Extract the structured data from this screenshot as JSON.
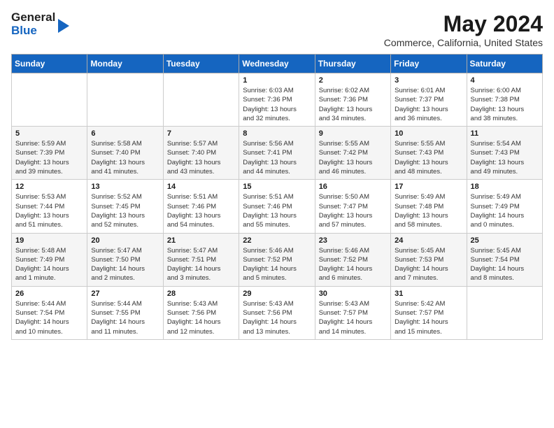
{
  "logo": {
    "general": "General",
    "blue": "Blue"
  },
  "title": "May 2024",
  "subtitle": "Commerce, California, United States",
  "days_of_week": [
    "Sunday",
    "Monday",
    "Tuesday",
    "Wednesday",
    "Thursday",
    "Friday",
    "Saturday"
  ],
  "weeks": [
    [
      {
        "day": "",
        "content": ""
      },
      {
        "day": "",
        "content": ""
      },
      {
        "day": "",
        "content": ""
      },
      {
        "day": "1",
        "content": "Sunrise: 6:03 AM\nSunset: 7:36 PM\nDaylight: 13 hours\nand 32 minutes."
      },
      {
        "day": "2",
        "content": "Sunrise: 6:02 AM\nSunset: 7:36 PM\nDaylight: 13 hours\nand 34 minutes."
      },
      {
        "day": "3",
        "content": "Sunrise: 6:01 AM\nSunset: 7:37 PM\nDaylight: 13 hours\nand 36 minutes."
      },
      {
        "day": "4",
        "content": "Sunrise: 6:00 AM\nSunset: 7:38 PM\nDaylight: 13 hours\nand 38 minutes."
      }
    ],
    [
      {
        "day": "5",
        "content": "Sunrise: 5:59 AM\nSunset: 7:39 PM\nDaylight: 13 hours\nand 39 minutes."
      },
      {
        "day": "6",
        "content": "Sunrise: 5:58 AM\nSunset: 7:40 PM\nDaylight: 13 hours\nand 41 minutes."
      },
      {
        "day": "7",
        "content": "Sunrise: 5:57 AM\nSunset: 7:40 PM\nDaylight: 13 hours\nand 43 minutes."
      },
      {
        "day": "8",
        "content": "Sunrise: 5:56 AM\nSunset: 7:41 PM\nDaylight: 13 hours\nand 44 minutes."
      },
      {
        "day": "9",
        "content": "Sunrise: 5:55 AM\nSunset: 7:42 PM\nDaylight: 13 hours\nand 46 minutes."
      },
      {
        "day": "10",
        "content": "Sunrise: 5:55 AM\nSunset: 7:43 PM\nDaylight: 13 hours\nand 48 minutes."
      },
      {
        "day": "11",
        "content": "Sunrise: 5:54 AM\nSunset: 7:43 PM\nDaylight: 13 hours\nand 49 minutes."
      }
    ],
    [
      {
        "day": "12",
        "content": "Sunrise: 5:53 AM\nSunset: 7:44 PM\nDaylight: 13 hours\nand 51 minutes."
      },
      {
        "day": "13",
        "content": "Sunrise: 5:52 AM\nSunset: 7:45 PM\nDaylight: 13 hours\nand 52 minutes."
      },
      {
        "day": "14",
        "content": "Sunrise: 5:51 AM\nSunset: 7:46 PM\nDaylight: 13 hours\nand 54 minutes."
      },
      {
        "day": "15",
        "content": "Sunrise: 5:51 AM\nSunset: 7:46 PM\nDaylight: 13 hours\nand 55 minutes."
      },
      {
        "day": "16",
        "content": "Sunrise: 5:50 AM\nSunset: 7:47 PM\nDaylight: 13 hours\nand 57 minutes."
      },
      {
        "day": "17",
        "content": "Sunrise: 5:49 AM\nSunset: 7:48 PM\nDaylight: 13 hours\nand 58 minutes."
      },
      {
        "day": "18",
        "content": "Sunrise: 5:49 AM\nSunset: 7:49 PM\nDaylight: 14 hours\nand 0 minutes."
      }
    ],
    [
      {
        "day": "19",
        "content": "Sunrise: 5:48 AM\nSunset: 7:49 PM\nDaylight: 14 hours\nand 1 minute."
      },
      {
        "day": "20",
        "content": "Sunrise: 5:47 AM\nSunset: 7:50 PM\nDaylight: 14 hours\nand 2 minutes."
      },
      {
        "day": "21",
        "content": "Sunrise: 5:47 AM\nSunset: 7:51 PM\nDaylight: 14 hours\nand 3 minutes."
      },
      {
        "day": "22",
        "content": "Sunrise: 5:46 AM\nSunset: 7:52 PM\nDaylight: 14 hours\nand 5 minutes."
      },
      {
        "day": "23",
        "content": "Sunrise: 5:46 AM\nSunset: 7:52 PM\nDaylight: 14 hours\nand 6 minutes."
      },
      {
        "day": "24",
        "content": "Sunrise: 5:45 AM\nSunset: 7:53 PM\nDaylight: 14 hours\nand 7 minutes."
      },
      {
        "day": "25",
        "content": "Sunrise: 5:45 AM\nSunset: 7:54 PM\nDaylight: 14 hours\nand 8 minutes."
      }
    ],
    [
      {
        "day": "26",
        "content": "Sunrise: 5:44 AM\nSunset: 7:54 PM\nDaylight: 14 hours\nand 10 minutes."
      },
      {
        "day": "27",
        "content": "Sunrise: 5:44 AM\nSunset: 7:55 PM\nDaylight: 14 hours\nand 11 minutes."
      },
      {
        "day": "28",
        "content": "Sunrise: 5:43 AM\nSunset: 7:56 PM\nDaylight: 14 hours\nand 12 minutes."
      },
      {
        "day": "29",
        "content": "Sunrise: 5:43 AM\nSunset: 7:56 PM\nDaylight: 14 hours\nand 13 minutes."
      },
      {
        "day": "30",
        "content": "Sunrise: 5:43 AM\nSunset: 7:57 PM\nDaylight: 14 hours\nand 14 minutes."
      },
      {
        "day": "31",
        "content": "Sunrise: 5:42 AM\nSunset: 7:57 PM\nDaylight: 14 hours\nand 15 minutes."
      },
      {
        "day": "",
        "content": ""
      }
    ]
  ]
}
